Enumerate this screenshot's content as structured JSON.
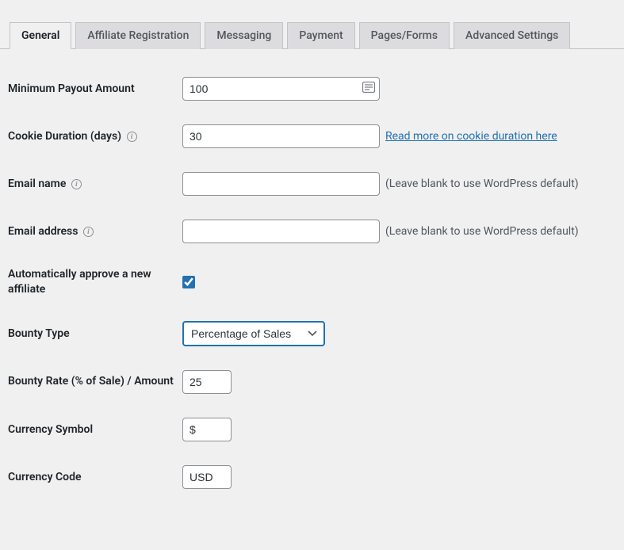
{
  "tabs": [
    {
      "label": "General",
      "active": true
    },
    {
      "label": "Affiliate Registration",
      "active": false
    },
    {
      "label": "Messaging",
      "active": false
    },
    {
      "label": "Payment",
      "active": false
    },
    {
      "label": "Pages/Forms",
      "active": false
    },
    {
      "label": "Advanced Settings",
      "active": false
    }
  ],
  "fields": {
    "minimum_payout": {
      "label": "Minimum Payout Amount",
      "value": "100"
    },
    "cookie_duration": {
      "label": "Cookie Duration (days)",
      "value": "30",
      "link_text": "Read more on cookie duration here"
    },
    "email_name": {
      "label": "Email name",
      "value": "",
      "hint": "(Leave blank to use WordPress default)"
    },
    "email_address": {
      "label": "Email address",
      "value": "",
      "hint": "(Leave blank to use WordPress default)"
    },
    "auto_approve": {
      "label": "Automatically approve a new affiliate",
      "checked": true
    },
    "bounty_type": {
      "label": "Bounty Type",
      "value": "Percentage of Sales"
    },
    "bounty_rate": {
      "label": "Bounty Rate (% of Sale) / Amount",
      "value": "25"
    },
    "currency_symbol": {
      "label": "Currency Symbol",
      "value": "$"
    },
    "currency_code": {
      "label": "Currency Code",
      "value": "USD"
    }
  },
  "help_char": "i"
}
